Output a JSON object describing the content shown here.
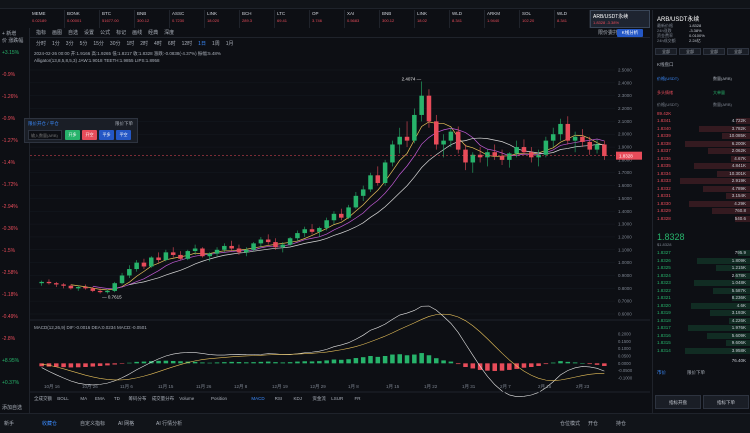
{
  "tickers": [
    {
      "name": "MEME",
      "value": "0.02189"
    },
    {
      "name": "BONK",
      "value": "0.00001"
    },
    {
      "name": "BTC",
      "value": "51677.00"
    },
    {
      "name": "BNB",
      "value": "300.12"
    },
    {
      "name": "ASSC",
      "value": "0.7230"
    },
    {
      "name": "LINK",
      "value": "18.020"
    },
    {
      "name": "BCH",
      "value": "289.3"
    },
    {
      "name": "LTC",
      "value": "69.41"
    },
    {
      "name": "OP",
      "value": "3.746"
    },
    {
      "name": "XAI",
      "value": "0.5683"
    },
    {
      "name": "BNB",
      "value": "300.12"
    },
    {
      "name": "LINK",
      "value": "18.02"
    },
    {
      "name": "WLD",
      "value": "8.341"
    },
    {
      "name": "ARKM",
      "value": "1.9440"
    },
    {
      "name": "SOL",
      "value": "102.20"
    },
    {
      "name": "WLD",
      "value": "8.341"
    }
  ],
  "active_tab": {
    "name": "ARB/USDT永续",
    "value": "1.8328 -3.38%"
  },
  "toolbar1": {
    "items": [
      "指标",
      "画图",
      "自选",
      "设置",
      "公式",
      "标记",
      "画线",
      "经典",
      "深度"
    ],
    "order": "限价委托",
    "ibtn": "K线分析"
  },
  "toolbar2": {
    "items": [
      "分时",
      "1分",
      "3分",
      "5分",
      "15分",
      "30分",
      "1时",
      "2时",
      "4时",
      "6时",
      "12时",
      "1日",
      "1周",
      "1月"
    ],
    "active": "1日"
  },
  "legend": {
    "line1": "2024-02-26 00:00  开:1.9166  高:1.9265  低:1.8217  收:1.8328  涨跌:-0.0838(-4.37%)  振幅:5.48%",
    "line2": "Alligator(13,8,5,8,5,3)   JAW:1.9018   TEETH:1.9855   LIPS:1.8958"
  },
  "order_box": {
    "title": "限价开仓 / 平仓",
    "tag": "限价下单",
    "placeholder": "输入数量(ARB)",
    "buttons": [
      "开多",
      "开空",
      "平多",
      "平空"
    ]
  },
  "macd_label": "MACD(12,26,9)   DIF:-0.0016   DEA:0.0234   MACD:-0.0501",
  "price_labels": [
    "2.5000",
    "2.4000",
    "2.3000",
    "2.2000",
    "2.1000",
    "2.0000",
    "1.9000",
    "1.8000",
    "1.7000",
    "1.6000",
    "1.5000",
    "1.4000",
    "1.3000",
    "1.2000",
    "1.1000",
    "1.0000",
    "0.9000",
    "0.8000",
    "0.7000",
    "0.6000"
  ],
  "current_price": "1.8328",
  "high_mark": "2.4074",
  "low_mark": "0.7615",
  "macd_axis": [
    "0.2000",
    "0.1500",
    "0.1000",
    "0.0500",
    "0.0000",
    "-0.0500",
    "-0.1000"
  ],
  "dates": [
    "10月 16",
    "10月 26",
    "11月 6",
    "11月 15",
    "11月 26",
    "12月 8",
    "12月 19",
    "12月 29",
    "1月 8",
    "1月 15",
    "1月 22",
    "1月 31",
    "2月 7",
    "2月 15",
    "2月 23"
  ],
  "left_pct": [
    "+3.15%",
    "-0.9%",
    "-1.26%",
    "-0.9%",
    "-1.27%",
    "-1.4%",
    "-1.72%",
    "-2.94%",
    "-0.36%",
    "-1.5%",
    "-2.58%",
    "-1.18%",
    "-0.49%",
    "-2.8%",
    "+8.95%",
    "+0.37%"
  ],
  "left_labels": {
    "top": "+ 新增",
    "top2": "价 涨跌幅",
    "bottom": "添加自选"
  },
  "indicators": [
    "全成交额",
    "BOLL",
    "MA",
    "EMA",
    "TD",
    "筹码分布",
    "成交量分布",
    "Volume",
    "Position",
    "MACD",
    "RSI",
    "KDJ",
    "资金流",
    "LSUR",
    "FR"
  ],
  "bottom_tabs": [
    "新手",
    "收藏仓",
    "自定义指标",
    "AI 网格",
    "AI 行情分析"
  ],
  "bottom_right": [
    "仓位模式",
    "开仓",
    "持仓"
  ],
  "right_panel": {
    "title": "ARB/USDT永续",
    "stats": [
      {
        "k": "最新价格",
        "v": "1.8328"
      },
      {
        "k": "24h涨跌",
        "v": "-3.38%"
      },
      {
        "k": "资金费率",
        "v": "0.0100%"
      },
      {
        "k": "24h成交额",
        "v": "2.24亿"
      }
    ],
    "btns": [
      "全部",
      "全部",
      "全部",
      "全部"
    ],
    "sub": "K线盘口",
    "order_info": [
      "价格(USDT)",
      "数量(ARB)"
    ],
    "sentiment": [
      "多头情绪",
      "大单量"
    ],
    "asks": [
      {
        "p": "1.8341",
        "q": "4.722K"
      },
      {
        "p": "1.8340",
        "q": "3.782K"
      },
      {
        "p": "1.8339",
        "q": "10.085K"
      },
      {
        "p": "1.8338",
        "q": "6.200K"
      },
      {
        "p": "1.8337",
        "q": "2.062K"
      },
      {
        "p": "1.8336",
        "q": "4.67K"
      },
      {
        "p": "1.8335",
        "q": "4.841K"
      },
      {
        "p": "1.8334",
        "q": "10.301K"
      },
      {
        "p": "1.8333",
        "q": "2.919K"
      },
      {
        "p": "1.8332",
        "q": "4.789K"
      },
      {
        "p": "1.8331",
        "q": "3.154K"
      },
      {
        "p": "1.8330",
        "q": "4.29K"
      },
      {
        "p": "1.8329",
        "q": "760.8"
      },
      {
        "p": "1.8328",
        "q": "540.6"
      }
    ],
    "ask_header": {
      "p": "价格(USDT)",
      "q": "数量(ARB)"
    },
    "ask_top": "89.42K",
    "mid_price": "1.8328",
    "mid_sub": "$1.8328",
    "bids": [
      {
        "p": "1.8327",
        "q": "795.9"
      },
      {
        "p": "1.8326",
        "q": "1.809K"
      },
      {
        "p": "1.8325",
        "q": "1.215K"
      },
      {
        "p": "1.8324",
        "q": "2.678K"
      },
      {
        "p": "1.8323",
        "q": "1.048K"
      },
      {
        "p": "1.8322",
        "q": "5.587K"
      },
      {
        "p": "1.8321",
        "q": "8.236K"
      },
      {
        "p": "1.8320",
        "q": "4.6K"
      },
      {
        "p": "1.8319",
        "q": "3.193K"
      },
      {
        "p": "1.8318",
        "q": "4.226K"
      },
      {
        "p": "1.8317",
        "q": "1.976K"
      },
      {
        "p": "1.8316",
        "q": "5.609K"
      },
      {
        "p": "1.8315",
        "q": "9.606K"
      },
      {
        "p": "1.8314",
        "q": "3.958K"
      }
    ],
    "bid_total": "76.40K",
    "bottom_tabs": [
      "市价",
      "限价下单"
    ],
    "actions": [
      "指标开盘",
      "指标下单"
    ]
  },
  "colors": {
    "up": "#27b36b",
    "down": "#e84c5a",
    "accent": "#3b8cff",
    "bg": "#0d0f14"
  },
  "chart_data": {
    "type": "candlestick",
    "range": [
      0.6,
      2.5
    ],
    "macd_range": [
      -0.1,
      0.2
    ],
    "candles": [
      [
        0.84,
        0.86,
        0.82,
        0.85
      ],
      [
        0.85,
        0.87,
        0.83,
        0.84
      ],
      [
        0.84,
        0.85,
        0.81,
        0.83
      ],
      [
        0.83,
        0.84,
        0.8,
        0.82
      ],
      [
        0.82,
        0.83,
        0.79,
        0.8
      ],
      [
        0.8,
        0.82,
        0.78,
        0.81
      ],
      [
        0.81,
        0.83,
        0.79,
        0.8
      ],
      [
        0.8,
        0.81,
        0.77,
        0.78
      ],
      [
        0.78,
        0.8,
        0.76,
        0.77
      ],
      [
        0.77,
        0.79,
        0.76,
        0.78
      ],
      [
        0.78,
        0.85,
        0.77,
        0.84
      ],
      [
        0.84,
        0.92,
        0.83,
        0.9
      ],
      [
        0.9,
        0.98,
        0.88,
        0.95
      ],
      [
        0.95,
        1.02,
        0.93,
        1.0
      ],
      [
        1.0,
        1.03,
        0.95,
        0.97
      ],
      [
        0.97,
        1.05,
        0.96,
        1.04
      ],
      [
        1.04,
        1.08,
        1.0,
        1.02
      ],
      [
        1.02,
        1.1,
        1.01,
        1.08
      ],
      [
        1.08,
        1.12,
        1.04,
        1.06
      ],
      [
        1.06,
        1.09,
        1.02,
        1.03
      ],
      [
        1.03,
        1.1,
        1.02,
        1.09
      ],
      [
        1.09,
        1.14,
        1.06,
        1.11
      ],
      [
        1.11,
        1.12,
        1.04,
        1.05
      ],
      [
        1.05,
        1.08,
        1.01,
        1.07
      ],
      [
        1.07,
        1.12,
        1.05,
        1.1
      ],
      [
        1.1,
        1.15,
        1.08,
        1.13
      ],
      [
        1.13,
        1.17,
        1.09,
        1.11
      ],
      [
        1.11,
        1.14,
        1.06,
        1.08
      ],
      [
        1.08,
        1.12,
        1.05,
        1.1
      ],
      [
        1.1,
        1.16,
        1.09,
        1.15
      ],
      [
        1.15,
        1.2,
        1.12,
        1.18
      ],
      [
        1.18,
        1.22,
        1.14,
        1.16
      ],
      [
        1.16,
        1.19,
        1.1,
        1.12
      ],
      [
        1.12,
        1.16,
        1.08,
        1.14
      ],
      [
        1.14,
        1.2,
        1.13,
        1.19
      ],
      [
        1.19,
        1.25,
        1.17,
        1.23
      ],
      [
        1.23,
        1.28,
        1.2,
        1.26
      ],
      [
        1.26,
        1.3,
        1.22,
        1.24
      ],
      [
        1.24,
        1.28,
        1.2,
        1.27
      ],
      [
        1.27,
        1.35,
        1.25,
        1.33
      ],
      [
        1.33,
        1.4,
        1.3,
        1.38
      ],
      [
        1.38,
        1.42,
        1.33,
        1.35
      ],
      [
        1.35,
        1.45,
        1.34,
        1.43
      ],
      [
        1.43,
        1.55,
        1.42,
        1.52
      ],
      [
        1.52,
        1.6,
        1.48,
        1.57
      ],
      [
        1.57,
        1.7,
        1.55,
        1.68
      ],
      [
        1.68,
        1.75,
        1.6,
        1.62
      ],
      [
        1.62,
        1.8,
        1.6,
        1.78
      ],
      [
        1.78,
        1.95,
        1.75,
        1.92
      ],
      [
        1.92,
        2.05,
        1.85,
        1.98
      ],
      [
        1.98,
        2.1,
        1.9,
        1.95
      ],
      [
        1.95,
        2.2,
        1.93,
        2.15
      ],
      [
        2.15,
        2.41,
        2.1,
        2.3
      ],
      [
        2.3,
        2.35,
        2.05,
        2.1
      ],
      [
        2.1,
        2.15,
        1.88,
        1.92
      ],
      [
        1.92,
        2.0,
        1.82,
        1.95
      ],
      [
        1.95,
        2.05,
        1.9,
        2.02
      ],
      [
        2.02,
        2.06,
        1.85,
        1.88
      ],
      [
        1.88,
        1.92,
        1.72,
        1.78
      ],
      [
        1.78,
        1.86,
        1.7,
        1.84
      ],
      [
        1.84,
        1.9,
        1.78,
        1.82
      ],
      [
        1.82,
        1.88,
        1.75,
        1.86
      ],
      [
        1.86,
        1.92,
        1.8,
        1.83
      ],
      [
        1.83,
        1.88,
        1.76,
        1.8
      ],
      [
        1.8,
        1.86,
        1.74,
        1.85
      ],
      [
        1.85,
        1.95,
        1.82,
        1.9
      ],
      [
        1.9,
        1.96,
        1.84,
        1.86
      ],
      [
        1.86,
        1.9,
        1.78,
        1.82
      ],
      [
        1.82,
        1.88,
        1.75,
        1.84
      ],
      [
        1.84,
        1.98,
        1.82,
        1.95
      ],
      [
        1.95,
        2.05,
        1.9,
        2.0
      ],
      [
        2.0,
        2.12,
        1.95,
        2.08
      ],
      [
        2.08,
        2.14,
        1.92,
        1.95
      ],
      [
        1.95,
        2.02,
        1.86,
        1.98
      ],
      [
        1.98,
        2.04,
        1.9,
        1.94
      ],
      [
        1.94,
        1.98,
        1.84,
        1.88
      ],
      [
        1.88,
        1.96,
        1.85,
        1.92
      ],
      [
        1.92,
        1.95,
        1.8,
        1.83
      ]
    ],
    "macd_hist": [
      -0.02,
      -0.022,
      -0.024,
      -0.026,
      -0.028,
      -0.027,
      -0.025,
      -0.022,
      -0.018,
      -0.014,
      -0.008,
      -0.002,
      0.004,
      0.01,
      0.012,
      0.015,
      0.017,
      0.018,
      0.016,
      0.014,
      0.012,
      0.01,
      0.006,
      0.004,
      0.006,
      0.008,
      0.01,
      0.009,
      0.007,
      0.008,
      0.01,
      0.012,
      0.008,
      0.006,
      0.008,
      0.012,
      0.014,
      0.013,
      0.015,
      0.02,
      0.026,
      0.024,
      0.028,
      0.036,
      0.042,
      0.05,
      0.044,
      0.05,
      0.06,
      0.062,
      0.055,
      0.06,
      0.07,
      0.055,
      0.035,
      0.02,
      0.012,
      -0.005,
      -0.025,
      -0.035,
      -0.045,
      -0.05,
      -0.052,
      -0.05,
      -0.045,
      -0.038,
      -0.03,
      -0.025,
      -0.018,
      -0.005,
      0.005,
      0.015,
      0.01,
      0.006,
      0.002,
      -0.005,
      -0.01,
      -0.018
    ]
  }
}
